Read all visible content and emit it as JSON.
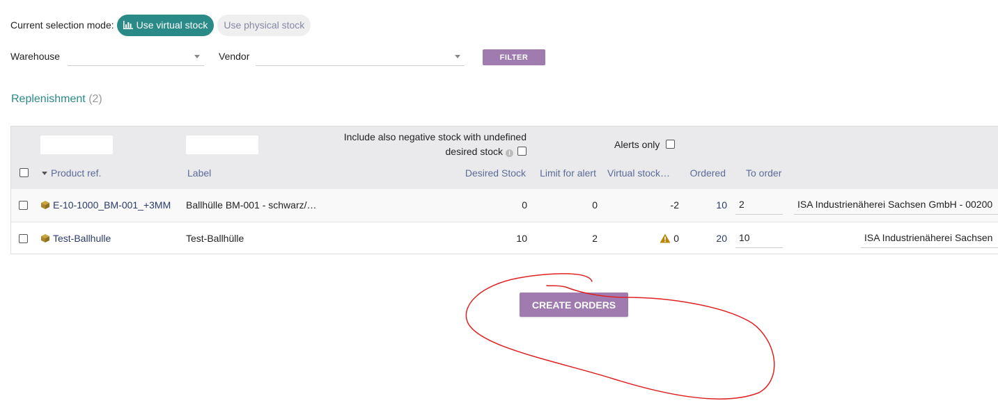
{
  "mode": {
    "label": "Current selection mode:",
    "virtual_label": "Use virtual stock",
    "physical_label": "Use physical stock"
  },
  "filters": {
    "warehouse_label": "Warehouse",
    "warehouse_value": "",
    "vendor_label": "Vendor",
    "vendor_value": "",
    "filter_button": "FILTER"
  },
  "section": {
    "title": "Replenishment",
    "count": "(2)"
  },
  "table": {
    "negative_stock_label_line1": "Include also negative stock with undefined",
    "negative_stock_label_line2": "desired stock",
    "alerts_only_label": "Alerts only",
    "columns": {
      "product_ref": "Product ref.",
      "label": "Label",
      "desired_stock": "Desired Stock",
      "limit_for_alert": "Limit for alert",
      "virtual_stock": "Virtual stock…",
      "ordered": "Ordered",
      "to_order": "To order"
    },
    "rows": [
      {
        "product_ref": "E-10-1000_BM-001_+3MM",
        "label": "Ballhülle BM-001 - schwarz/…",
        "desired_stock": "0",
        "limit_for_alert": "0",
        "virtual_stock": "-2",
        "ordered": "10",
        "to_order": "2",
        "vendor": "ISA Industrienäherei Sachsen GmbH - 00200"
      },
      {
        "product_ref": "Test-Ballhulle",
        "label": "Test-Ballhülle",
        "desired_stock": "10",
        "limit_for_alert": "2",
        "virtual_stock": "0",
        "ordered": "20",
        "to_order": "10",
        "vendor": "ISA Industrienäherei Sachsen"
      }
    ]
  },
  "actions": {
    "create_orders": "CREATE ORDERS"
  },
  "colors": {
    "accent_teal": "#2a8a88",
    "button_purple": "#a07bb0",
    "annotation_red": "#e02020",
    "warning_gold": "#b8860b"
  }
}
